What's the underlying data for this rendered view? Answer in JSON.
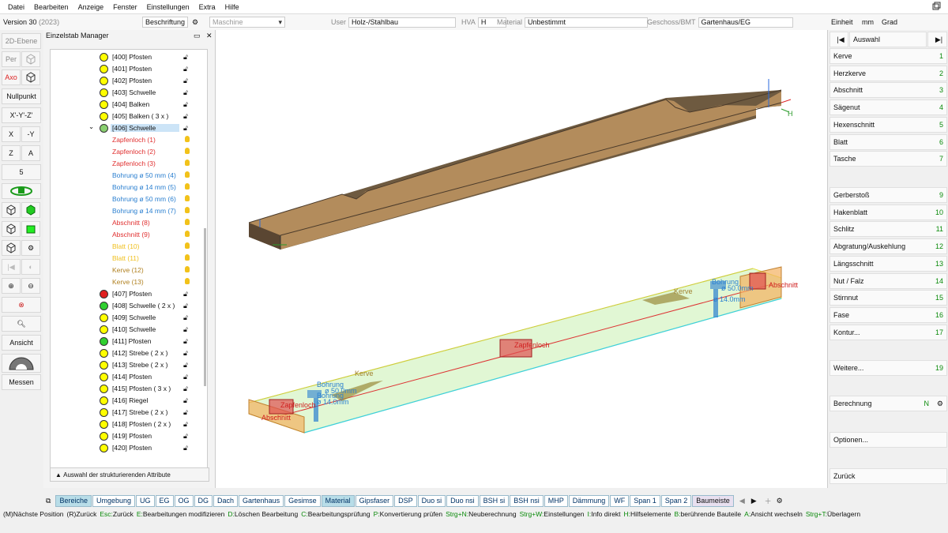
{
  "menu": [
    "Datei",
    "Bearbeiten",
    "Anzeige",
    "Fenster",
    "Einstellungen",
    "Extra",
    "Hilfe"
  ],
  "toolbar": {
    "version": "Version 30",
    "version_year": "(2023)",
    "beschriftung": "Beschriftung",
    "maschine": "Maschine",
    "user_label": "User",
    "user_value": "Holz-/Stahlbau",
    "hva_label": "HVA",
    "hva_value": "H",
    "material_label": "Material",
    "material_value": "Unbestimmt",
    "geschoss_label": "Geschoss/BMT",
    "geschoss_value": "Gartenhaus/EG",
    "einheit": "Einheit",
    "unit": "mm",
    "angle": "Grad"
  },
  "left": {
    "ebene": "2D-Ebene",
    "per": "Per",
    "axo": "Axo",
    "nullpunkt": "Nullpunkt",
    "xyz": "X'-Y'-Z'",
    "x": "X",
    "my": "-Y",
    "z": "Z",
    "a": "A",
    "five": "5",
    "ansicht": "Ansicht",
    "messen": "Messen"
  },
  "panel": {
    "title": "Einzelstab Manager",
    "attr_button": "Auswahl der strukturierenden Attribute"
  },
  "tree": [
    {
      "label": "[400] Pfosten",
      "color": "#ffff00"
    },
    {
      "label": "[401] Pfosten",
      "color": "#ffff00"
    },
    {
      "label": "[402] Pfosten",
      "color": "#ffff00"
    },
    {
      "label": "[403] Schwelle",
      "color": "#ffff00"
    },
    {
      "label": "[404] Balken",
      "color": "#ffff00"
    },
    {
      "label": "[405] Balken ( 3 x )",
      "color": "#ffff00"
    },
    {
      "label": "[406] Schwelle",
      "color": "#8ad070",
      "selected": true
    }
  ],
  "subitems": [
    {
      "label": "Zapfenloch (1)",
      "color": "#e03030"
    },
    {
      "label": "Zapfenloch (2)",
      "color": "#e03030"
    },
    {
      "label": "Zapfenloch (3)",
      "color": "#e03030"
    },
    {
      "label": "Bohrung ø 50 mm (4)",
      "color": "#2a7fd0"
    },
    {
      "label": "Bohrung ø 14 mm (5)",
      "color": "#2a7fd0"
    },
    {
      "label": "Bohrung ø 50 mm (6)",
      "color": "#2a7fd0"
    },
    {
      "label": "Bohrung ø 14 mm (7)",
      "color": "#2a7fd0"
    },
    {
      "label": "Abschnitt (8)",
      "color": "#e03030"
    },
    {
      "label": "Abschnitt (9)",
      "color": "#e03030"
    },
    {
      "label": "Blatt (10)",
      "color": "#f0c020"
    },
    {
      "label": "Blatt (11)",
      "color": "#f0c020"
    },
    {
      "label": "Kerve (12)",
      "color": "#b08020"
    },
    {
      "label": "Kerve (13)",
      "color": "#b08020"
    }
  ],
  "tree2": [
    {
      "label": "[407] Pfosten",
      "color": "#e02020"
    },
    {
      "label": "[408] Schwelle ( 2 x )",
      "color": "#30d030"
    },
    {
      "label": "[409] Schwelle",
      "color": "#ffff00"
    },
    {
      "label": "[410] Schwelle",
      "color": "#ffff00"
    },
    {
      "label": "[411] Pfosten",
      "color": "#30d030"
    },
    {
      "label": "[412] Strebe ( 2 x )",
      "color": "#ffff00"
    },
    {
      "label": "[413] Strebe ( 2 x )",
      "color": "#ffff00"
    },
    {
      "label": "[414] Pfosten",
      "color": "#ffff00"
    },
    {
      "label": "[415] Pfosten ( 3 x )",
      "color": "#ffff00"
    },
    {
      "label": "[416] Riegel",
      "color": "#ffff00"
    },
    {
      "label": "[417] Strebe ( 2 x )",
      "color": "#ffff00"
    },
    {
      "label": "[418] Pfosten ( 2 x )",
      "color": "#ffff00"
    },
    {
      "label": "[419] Pfosten",
      "color": "#ffff00"
    },
    {
      "label": "[420] Pfosten",
      "color": "#ffff00"
    }
  ],
  "viewport": {
    "lbl_kerve1": "Kerve",
    "lbl_kerve2": "Kerve",
    "lbl_zapfen1": "Zapfenloch",
    "lbl_zapfen2": "Zapfenloch",
    "lbl_abschnitt1": "Abschnitt",
    "lbl_abschnitt2": "Abschnitt",
    "lbl_bohrung1": "Bohrung",
    "lbl_bohrung2": "Bohrung",
    "lbl_dim1": "ø 50.0mm",
    "lbl_dim2": "ø 14.0mm",
    "lbl_bohrung3": "Bohrung",
    "lbl_dim3": "ø 50.0mm",
    "lbl_dim4": "ø 14.0mm",
    "axis_h": "H"
  },
  "right": {
    "auswahl": "Auswahl",
    "items": [
      {
        "label": "Kerve",
        "n": "1"
      },
      {
        "label": "Herzkerve",
        "n": "2"
      },
      {
        "label": "Abschnitt",
        "n": "3"
      },
      {
        "label": "Sägenut",
        "n": "4"
      },
      {
        "label": "Hexenschnitt",
        "n": "5"
      },
      {
        "label": "Blatt",
        "n": "6"
      },
      {
        "label": "Tasche",
        "n": "7"
      }
    ],
    "items2": [
      {
        "label": "Gerberstoß",
        "n": "9"
      },
      {
        "label": "Hakenblatt",
        "n": "10"
      },
      {
        "label": "Schlitz",
        "n": "11"
      },
      {
        "label": "Abgratung/Auskehlung",
        "n": "12"
      },
      {
        "label": "Längsschnitt",
        "n": "13"
      },
      {
        "label": "Nut / Falz",
        "n": "14"
      },
      {
        "label": "Stirnnut",
        "n": "15"
      },
      {
        "label": "Fase",
        "n": "16"
      },
      {
        "label": "Kontur...",
        "n": "17"
      }
    ],
    "weitere": "Weitere...",
    "weitere_n": "19",
    "berechnung": "Berechnung",
    "berechnung_n": "N",
    "optionen": "Optionen...",
    "zurueck": "Zurück"
  },
  "tabs": [
    "Bereiche",
    "Umgebung",
    "UG",
    "EG",
    "OG",
    "DG",
    "Dach",
    "Gartenhaus",
    "Gesimse",
    "Material",
    "Gipsfaser",
    "DSP",
    "Duo si",
    "Duo nsi",
    "BSH si",
    "BSH nsi",
    "MHP",
    "Dämmung",
    "WF",
    "Span 1",
    "Span 2",
    "Baumeiste"
  ],
  "status": [
    [
      "(M)",
      "Nächste Position"
    ],
    [
      "(R)",
      "Zurück"
    ],
    [
      "Esc:",
      "Zurück"
    ],
    [
      "E:",
      "Bearbeitungen modifizieren"
    ],
    [
      "D:",
      "Löschen Bearbeitung"
    ],
    [
      "C:",
      "Bearbeitungsprüfung"
    ],
    [
      "P:",
      "Konvertierung prüfen"
    ],
    [
      "Strg+N:",
      "Neuberechnung"
    ],
    [
      "Strg+W:",
      "Einstellungen"
    ],
    [
      "I:",
      "Info direkt"
    ],
    [
      "H:",
      "Hilfselemente"
    ],
    [
      "B:",
      "berührende Bauteile"
    ],
    [
      "A:",
      "Ansicht wechseln"
    ],
    [
      "Strg+T:",
      "Überlagern"
    ]
  ]
}
